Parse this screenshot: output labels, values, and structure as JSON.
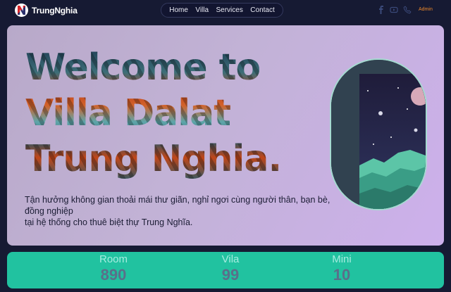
{
  "header": {
    "brand": "TrungNghia",
    "nav": [
      "Home",
      "Villa",
      "Services",
      "Contact"
    ],
    "social_icons": [
      "facebook-icon",
      "youtube-icon",
      "phone-icon"
    ],
    "admin_label": "Admin"
  },
  "hero": {
    "title_line1": "Welcome to",
    "title_line2": "Villa Dalat",
    "title_line3": "Trung Nghia.",
    "desc_line1": "Tận hưởng không gian thoải mái thư giãn, nghỉ ngơi cùng người thân, bạn bè, đồng nghiệp",
    "desc_line2": "tại hệ thống cho thuê biệt thự Trung Nghĩa."
  },
  "stats": [
    {
      "label": "Room",
      "value": "890"
    },
    {
      "label": "Vila",
      "value": "99"
    },
    {
      "label": "Mini",
      "value": "10"
    }
  ],
  "colors": {
    "page_bg": "#161a33",
    "accent": "#21c2a0",
    "admin": "#f08a2a"
  }
}
